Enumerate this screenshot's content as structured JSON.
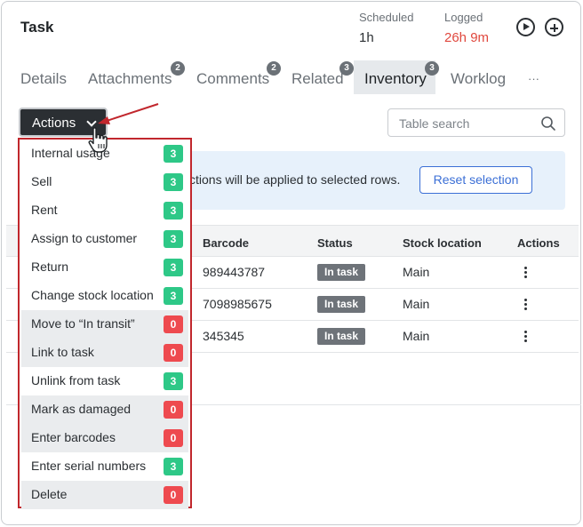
{
  "header": {
    "title": "Task",
    "scheduled_label": "Scheduled",
    "scheduled_value": "1h",
    "logged_label": "Logged",
    "logged_value": "26h 9m",
    "play_icon": "play-circle-icon",
    "add_icon": "plus-circle-icon"
  },
  "tabs": [
    {
      "label": "Details"
    },
    {
      "label": "Attachments",
      "count": "2"
    },
    {
      "label": "Comments",
      "count": "2"
    },
    {
      "label": "Related",
      "count": "3"
    },
    {
      "label": "Inventory",
      "count": "3",
      "active": true
    },
    {
      "label": "Worklog"
    },
    {
      "label": "···"
    }
  ],
  "toolbar": {
    "actions_label": "Actions",
    "search_placeholder": "Table search"
  },
  "info": {
    "message": "ctions will be applied to selected rows.",
    "reset_label": "Reset selection"
  },
  "table": {
    "columns": [
      "Barcode",
      "Status",
      "Stock location",
      "Actions"
    ],
    "rows": [
      {
        "barcode": "989443787",
        "status": "In task",
        "location": "Main"
      },
      {
        "barcode": "7098985675",
        "status": "In task",
        "location": "Main"
      },
      {
        "barcode": "345345",
        "status": "In task",
        "location": "Main"
      }
    ]
  },
  "actions_menu": [
    {
      "label": "Internal usage",
      "count": "3",
      "color": "green"
    },
    {
      "label": "Sell",
      "count": "3",
      "color": "green"
    },
    {
      "label": "Rent",
      "count": "3",
      "color": "green"
    },
    {
      "label": "Assign to customer",
      "count": "3",
      "color": "green"
    },
    {
      "label": "Return",
      "count": "3",
      "color": "green"
    },
    {
      "label": "Change stock location",
      "count": "3",
      "color": "green"
    },
    {
      "label": "Move to “In transit”",
      "count": "0",
      "color": "red"
    },
    {
      "label": "Link to task",
      "count": "0",
      "color": "red"
    },
    {
      "label": "Unlink from task",
      "count": "3",
      "color": "green"
    },
    {
      "label": "Mark as damaged",
      "count": "0",
      "color": "red"
    },
    {
      "label": "Enter barcodes",
      "count": "0",
      "color": "red"
    },
    {
      "label": "Enter serial numbers",
      "count": "3",
      "color": "green"
    },
    {
      "label": "Delete",
      "count": "0",
      "color": "red"
    }
  ],
  "colors": {
    "accent": "#3b6fd6",
    "highlight": "#c1272d",
    "badge_green": "#2ec887",
    "badge_red": "#ee4a4f",
    "logged": "#e0483e"
  }
}
